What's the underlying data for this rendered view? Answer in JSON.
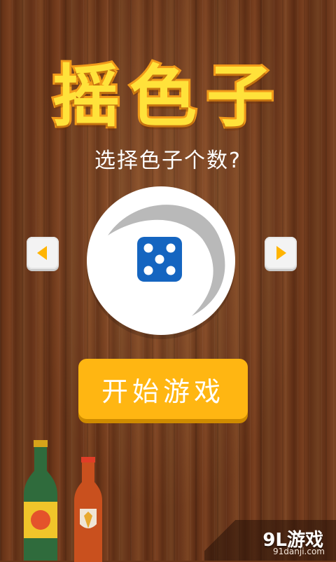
{
  "app": {
    "title": "摇色子",
    "subtitle": "选择色子个数?"
  },
  "selector": {
    "prev_icon": "triangle-left-icon",
    "next_icon": "triangle-right-icon",
    "dice_face_value": 5,
    "dice_icon": "dice-five-icon"
  },
  "start_button": {
    "label": "开始游戏"
  },
  "watermark": {
    "brand": "9L游戏",
    "url": "91danji.com"
  },
  "colors": {
    "title_fill": "#ffe23a",
    "title_stroke": "#f29a1a",
    "button_yellow": "#ffb612",
    "dice_blue": "#1565c0",
    "arrow_orange": "#ffb400"
  }
}
